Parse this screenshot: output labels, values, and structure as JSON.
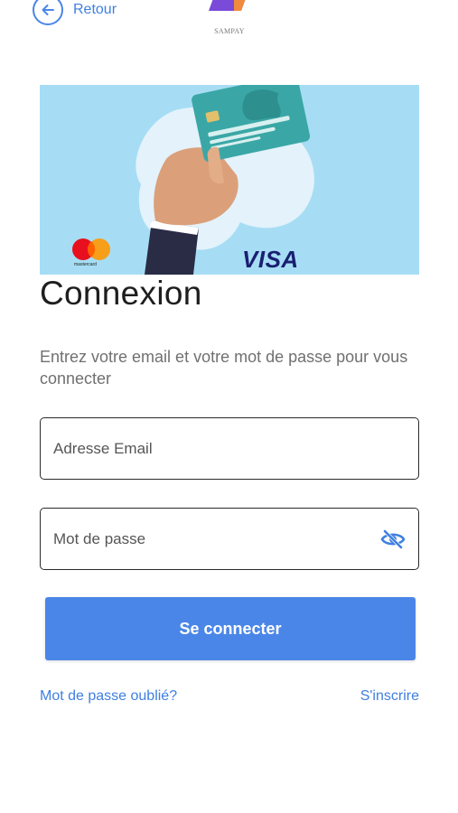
{
  "header": {
    "back_label": "Retour",
    "brand_name": "SAMPAY"
  },
  "banner": {
    "card_brand_left": "mastercard",
    "card_brand_right": "VISA"
  },
  "login": {
    "title": "Connexion",
    "subtitle": "Entrez votre email et votre mot de passe pour vous connecter",
    "email_placeholder": "Adresse Email",
    "password_placeholder": "Mot de passe",
    "submit_label": "Se connecter",
    "forgot_label": "Mot de passe oublié?",
    "signup_label": "S'inscrire"
  },
  "icons": {
    "back": "arrow-left-circle-icon",
    "password_toggle": "eye-off-icon"
  },
  "colors": {
    "accent": "#4a86e8",
    "link": "#3f7fe0",
    "banner_bg": "#a6ddf4"
  }
}
